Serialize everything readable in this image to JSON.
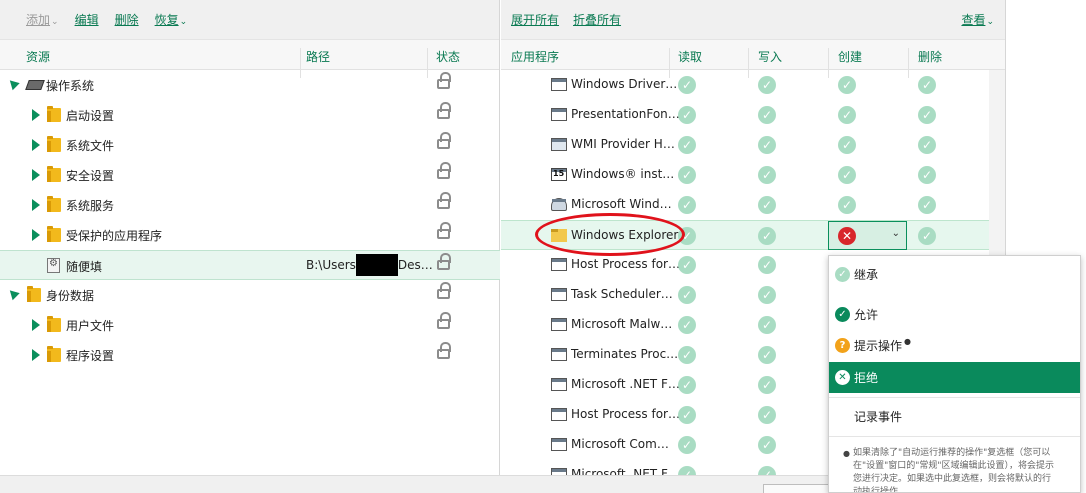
{
  "left_toolbar": {
    "add": "添加",
    "edit": "编辑",
    "delete": "删除",
    "restore": "恢复"
  },
  "left_headers": {
    "resource": "资源",
    "path": "路径",
    "status": "状态"
  },
  "tree": [
    {
      "label": "操作系统",
      "level": 0,
      "expanded": true,
      "icon": "chip-icon"
    },
    {
      "label": "启动设置",
      "level": 1,
      "expanded": false,
      "icon": "folder-icon"
    },
    {
      "label": "系统文件",
      "level": 1,
      "expanded": false,
      "icon": "folder-icon"
    },
    {
      "label": "安全设置",
      "level": 1,
      "expanded": false,
      "icon": "folder-icon"
    },
    {
      "label": "系统服务",
      "level": 1,
      "expanded": false,
      "icon": "folder-icon"
    },
    {
      "label": "受保护的应用程序",
      "level": 1,
      "expanded": false,
      "icon": "folder-icon"
    },
    {
      "label": "随便填",
      "level": 1,
      "expanded": null,
      "icon": "settings-file-icon",
      "path_start": "B:\\Users",
      "path_end": "Des…"
    },
    {
      "label": "身份数据",
      "level": 0,
      "expanded": true,
      "icon": "folder-icon"
    },
    {
      "label": "用户文件",
      "level": 1,
      "expanded": false,
      "icon": "folder-icon"
    },
    {
      "label": "程序设置",
      "level": 1,
      "expanded": false,
      "icon": "folder-icon"
    }
  ],
  "right_toolbar": {
    "expand_all": "展开所有",
    "collapse_all": "折叠所有",
    "view": "查看"
  },
  "right_headers": {
    "app": "应用程序",
    "read": "读取",
    "write": "写入",
    "create": "创建",
    "delete": "删除"
  },
  "apps": [
    {
      "name": "Windows Driver…",
      "icon": "window-icon"
    },
    {
      "name": "PresentationFon…",
      "icon": "window-icon"
    },
    {
      "name": "WMI Provider H…",
      "icon": "setup-icon"
    },
    {
      "name": "Windows® inst…",
      "icon": "installer-icon"
    },
    {
      "name": "Microsoft Wind…",
      "icon": "user-icon"
    },
    {
      "name": "Windows Explorer",
      "icon": "folder-icon"
    },
    {
      "name": "Host Process for…",
      "icon": "window-icon"
    },
    {
      "name": "Task Scheduler…",
      "icon": "window-icon"
    },
    {
      "name": "Microsoft Malw…",
      "icon": "window-icon"
    },
    {
      "name": "Terminates Proc…",
      "icon": "window-icon"
    },
    {
      "name": "Microsoft .NET F…",
      "icon": "window-icon"
    },
    {
      "name": "Host Process for…",
      "icon": "window-icon"
    },
    {
      "name": "Microsoft Com…",
      "icon": "window-icon"
    },
    {
      "name": "Microsoft .NET F…",
      "icon": "window-icon"
    }
  ],
  "selected_app": "Windows Explorer",
  "selected_cell_value": "拒绝",
  "dropdown": {
    "inherit": "继承",
    "allow": "允许",
    "prompt": "提示操作",
    "deny": "拒绝",
    "log_events": "记录事件",
    "note": "如果清除了\"自动运行推荐的操作\"复选框（您可以在\"设置\"窗口的\"常规\"区域编辑此设置），将会提示您进行决定。如果选中此复选框，则会将默认的行动执行操作。"
  },
  "colors": {
    "accent": "#0a8a5c",
    "check": "#a9dcc3",
    "deny": "#d8262b",
    "annotation": "#e0121b"
  }
}
